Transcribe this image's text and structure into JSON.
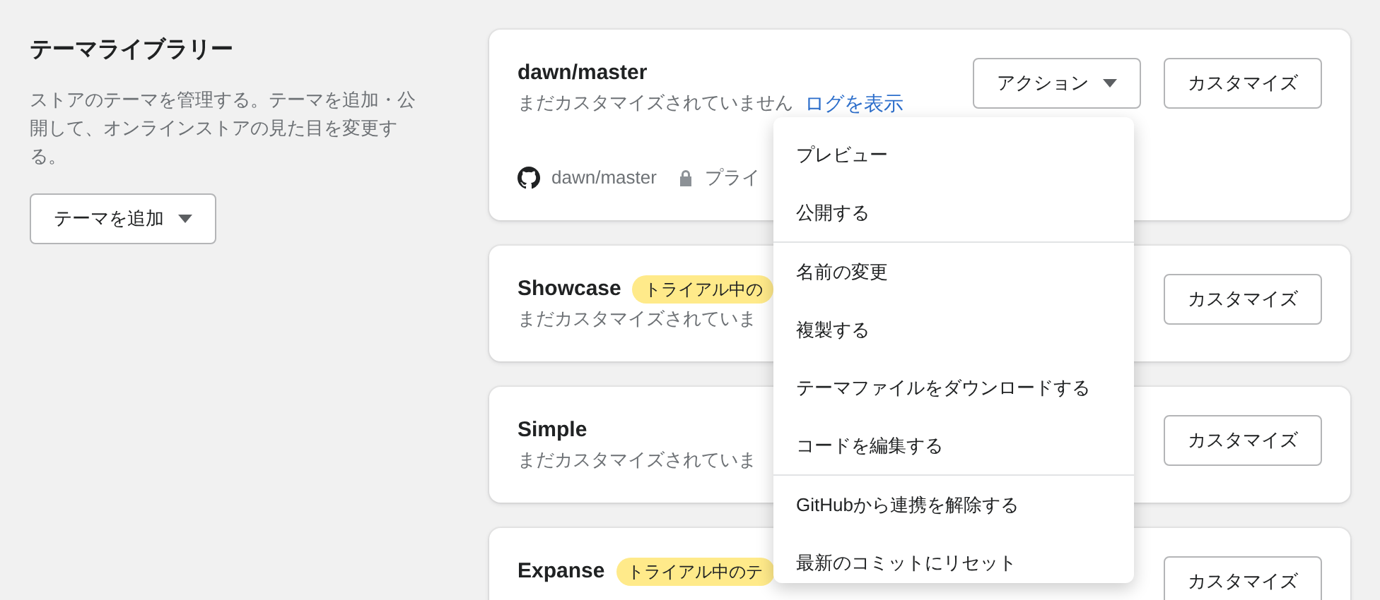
{
  "library": {
    "title": "テーマライブラリー",
    "description": "ストアのテーマを管理する。テーマを追加・公開して、オンラインストアの見た目を変更する。",
    "add_button": "テーマを追加"
  },
  "themes": [
    {
      "name": "dawn/master",
      "subtitle": "まだカスタマイズされていません",
      "log_link": "ログを表示",
      "actions_button": "アクション",
      "customize_button": "カスタマイズ",
      "repo": "dawn/master",
      "visibility": "プライ"
    },
    {
      "name": "Showcase",
      "badge": "トライアル中の",
      "subtitle": "まだカスタマイズされていま",
      "customize_button": "カスタマイズ"
    },
    {
      "name": "Simple",
      "subtitle": "まだカスタマイズされていま",
      "customize_button": "カスタマイズ"
    },
    {
      "name": "Expanse",
      "badge": "トライアル中のテ",
      "customize_button": "カスタマイズ"
    }
  ],
  "action_menu": {
    "sections": [
      [
        "プレビュー",
        "公開する"
      ],
      [
        "名前の変更",
        "複製する",
        "テーマファイルをダウンロードする",
        "コードを編集する"
      ],
      [
        "GitHubから連携を解除する",
        "最新のコミットにリセット"
      ]
    ]
  }
}
